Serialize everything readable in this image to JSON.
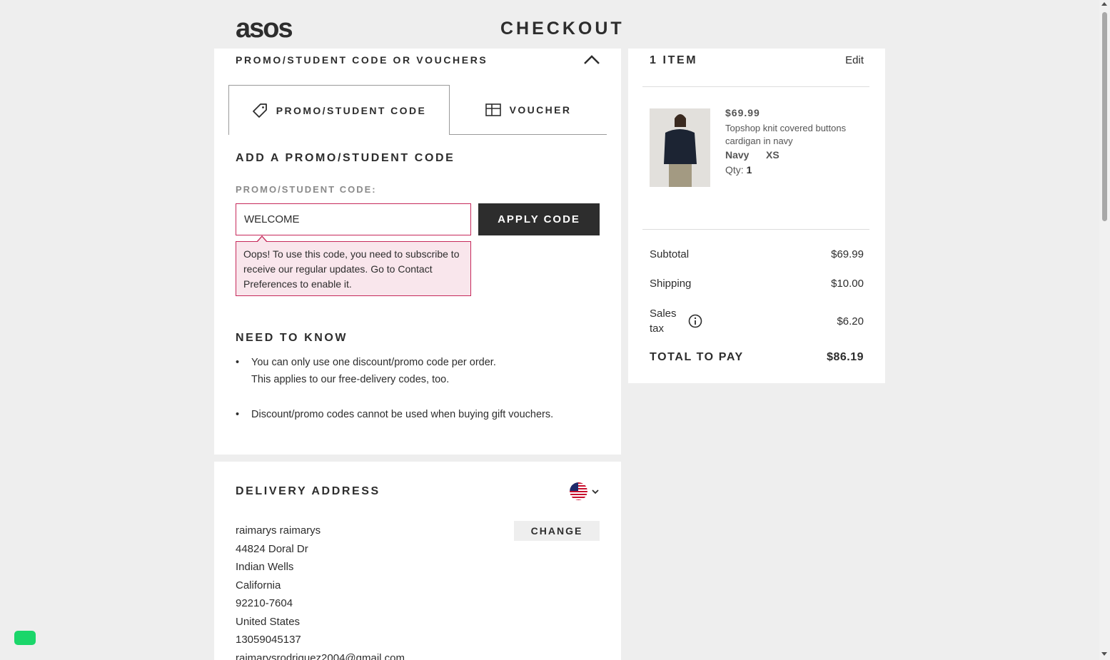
{
  "header": {
    "logo": "asos",
    "title": "CHECKOUT"
  },
  "promo": {
    "heading": "PROMO/STUDENT CODE OR VOUCHERS",
    "tabs": [
      {
        "label": "PROMO/STUDENT CODE",
        "icon": "tag-icon",
        "active": true
      },
      {
        "label": "VOUCHER",
        "icon": "voucher-icon",
        "active": false
      }
    ],
    "add_heading": "ADD A PROMO/STUDENT CODE",
    "field_label": "PROMO/STUDENT CODE:",
    "input_value": "WELCOME",
    "apply_label": "APPLY CODE",
    "error_text": "Oops! To use this code, you need to subscribe to receive our regular updates. Go to Contact Preferences to enable it.",
    "error_color": "#c6295b",
    "need_heading": "NEED TO KNOW",
    "need_items": [
      {
        "line1": "You can only use one discount/promo code per order.",
        "line2": "This applies to our free-delivery codes, too."
      },
      {
        "line1": "Discount/promo codes cannot be used when buying gift vouchers.",
        "line2": ""
      }
    ]
  },
  "delivery": {
    "heading": "DELIVERY ADDRESS",
    "country_flag": "us-flag-icon",
    "change_label": "CHANGE",
    "address_lines": [
      "raimarys raimarys",
      "44824 Doral Dr",
      "Indian Wells",
      "California",
      "92210-7604",
      "United States",
      "13059045137",
      "raimarysrodriguez2004@gmail.com"
    ]
  },
  "summary": {
    "items_heading": "1 ITEM",
    "edit_label": "Edit",
    "product": {
      "price": "$69.99",
      "name": "Topshop knit covered buttons cardigan in navy",
      "color": "Navy",
      "size": "XS",
      "qty_label": "Qty:",
      "qty": "1"
    },
    "rows": {
      "subtotal_label": "Subtotal",
      "subtotal_value": "$69.99",
      "shipping_label": "Shipping",
      "shipping_value": "$10.00",
      "tax_label": "Sales tax",
      "tax_value": "$6.20",
      "total_label": "TOTAL TO PAY",
      "total_value": "$86.19"
    }
  },
  "colors": {
    "dark": "#2d2d2d",
    "background": "#eeeeee",
    "chat_badge": "#1bd66a"
  }
}
